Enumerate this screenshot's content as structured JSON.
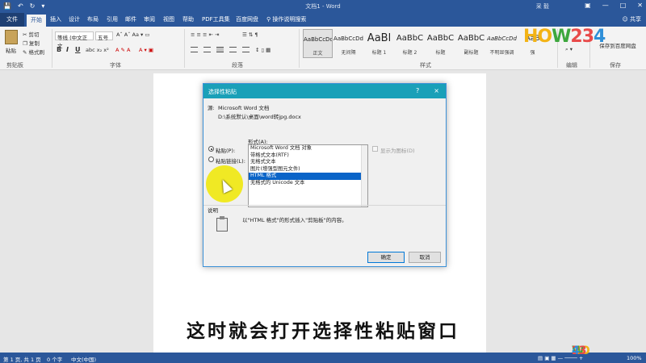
{
  "titlebar": {
    "title": "文档1 - Word",
    "user": "采 毅"
  },
  "tabs": [
    "开始",
    "插入",
    "设计",
    "布局",
    "引用",
    "邮件",
    "审阅",
    "视图",
    "帮助",
    "PDF工具集",
    "百度网盘"
  ],
  "file_tab": "文件",
  "search_hint": "操作说明搜索",
  "share": "共享",
  "ribbon": {
    "paste": "粘贴",
    "cut": "剪切",
    "copy": "复制",
    "format_painter": "格式刷",
    "clipboard_label": "剪贴板",
    "font_name": "等线 (中文正文",
    "font_size": "五号",
    "font_label": "字体",
    "paragraph_label": "段落",
    "styles_label": "样式",
    "editing_label": "编辑",
    "save_label": "保存",
    "save_button": "保存到百度网盘",
    "styles": [
      {
        "sample": "AaBbCcDd",
        "name": "正文"
      },
      {
        "sample": "AaBbCcDd",
        "name": "无间隔"
      },
      {
        "sample": "AaBl",
        "name": "标题 1"
      },
      {
        "sample": "AaBbC",
        "name": "标题 2"
      },
      {
        "sample": "AaBbC",
        "name": "标题"
      },
      {
        "sample": "AaBbC",
        "name": "副标题"
      },
      {
        "sample": "AaBbCcDd",
        "name": "不明显强调"
      },
      {
        "sample": "AaB",
        "name": "强"
      }
    ]
  },
  "dialog": {
    "title": "选择性粘贴",
    "help": "?",
    "close": "×",
    "source_label": "源:",
    "source_app": "Microsoft Word 文档",
    "source_path": "D:\\系统默认\\桌面\\word转jpg.docx",
    "format_label": "形式(A):",
    "paste_option": "粘贴(P):",
    "paste_link_option": "粘贴链接(L):",
    "formats": [
      "Microsoft Word 文档 对象",
      "带格式文本(RTF)",
      "无格式文本",
      "图片(增强型图元文件)",
      "HTML 格式",
      "无格式的 Unicode 文本"
    ],
    "selected_format_index": 4,
    "display_as_icon": "显示为图标(D)",
    "description_label": "说明",
    "description_text": "以\"HTML 格式\"的形式插入\"剪贴板\"的内容。",
    "ok": "确定",
    "cancel": "取消"
  },
  "status": {
    "page": "第 1 页, 共 1 页",
    "words": "0 个字",
    "language": "中文(中国)",
    "zoom": "100%"
  },
  "subtitle": "这时就会打开选择性粘贴窗口",
  "logo": {
    "parts": [
      "HO",
      "W",
      "23",
      "4"
    ]
  },
  "colors": {
    "accent": "#2b579a",
    "dialog_title": "#1aa0b8",
    "selection": "#0a64c8",
    "highlight": "#f0e800"
  }
}
